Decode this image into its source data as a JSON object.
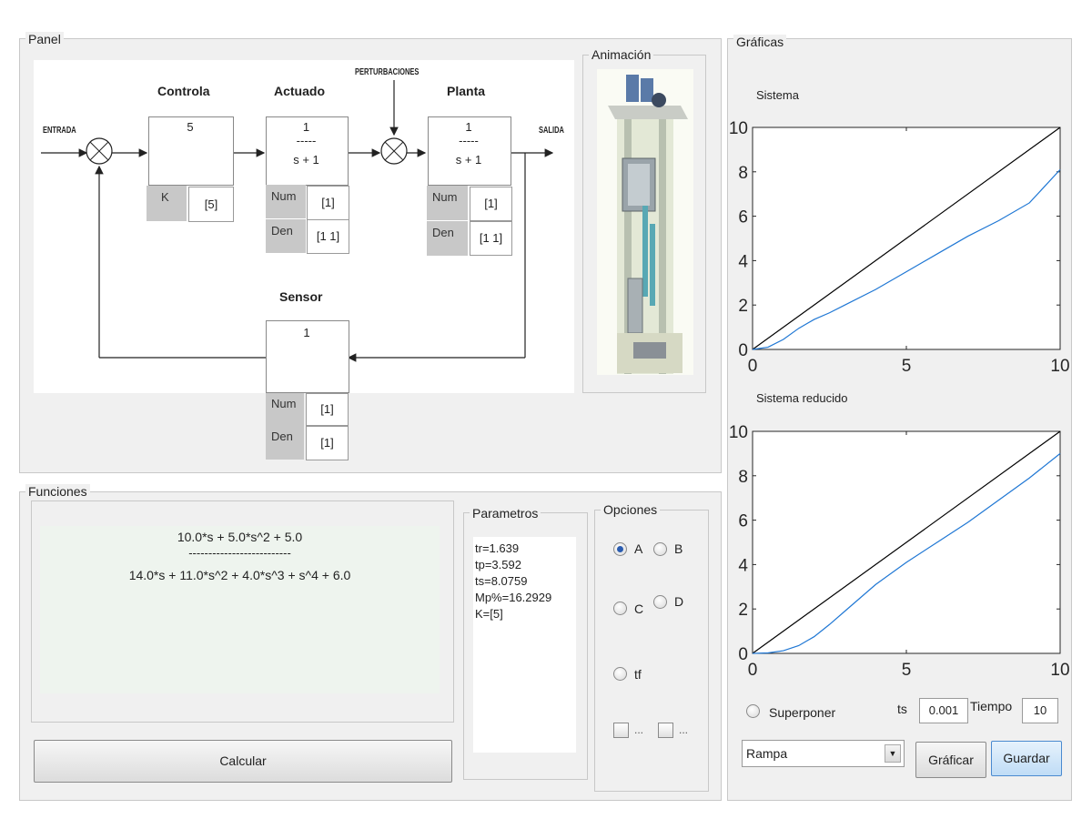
{
  "panel": {
    "title": "Panel",
    "diagram": {
      "entrada": "ENTRADA",
      "salida": "SALIDA",
      "perturbaciones": "PERTURBACIONES",
      "controlador": {
        "title": "Controla",
        "value": "5",
        "k_label": "K",
        "k_value": "[5]"
      },
      "actuador": {
        "title": "Actuado",
        "num_text": "1",
        "den_text": "s + 1",
        "num_label": "Num",
        "num_value": "[1]",
        "den_label": "Den",
        "den_value": "[1 1]"
      },
      "planta": {
        "title": "Planta",
        "num_text": "1",
        "den_text": "s + 1",
        "num_label": "Num",
        "num_value": "[1]",
        "den_label": "Den",
        "den_value": "[1 1]"
      },
      "sensor": {
        "title": "Sensor",
        "value": "1",
        "num_label": "Num",
        "num_value": "[1]",
        "den_label": "Den",
        "den_value": "[1]"
      },
      "frac_line": "-----"
    },
    "animacion_title": "Animación"
  },
  "funciones": {
    "title": "Funciones",
    "numerator": "10.0*s + 5.0*s^2 + 5.0",
    "fraction_bar": "--------------------------",
    "denominator": "14.0*s + 11.0*s^2 + 4.0*s^3 + s^4 + 6.0",
    "calcular_label": "Calcular"
  },
  "parametros": {
    "title": "Parametros",
    "lines": [
      "tr=1.639",
      "tp=3.592",
      "ts=8.0759",
      "Mp%=16.2929",
      "K=[5]"
    ]
  },
  "opciones": {
    "title": "Opciones",
    "radio_a": "A",
    "radio_b": "B",
    "radio_c": "C",
    "radio_d": "D",
    "radio_tf": "tf",
    "check1": "...",
    "check2": "...",
    "selected": "A"
  },
  "graficas": {
    "title": "Gráficas",
    "superponer_label": "Superponer",
    "ts_label": "ts",
    "ts_value": "0.001",
    "tiempo_label": "Tiempo",
    "tiempo_value": "10",
    "signal_selected": "Rampa",
    "graficar_label": "Gráficar",
    "guardar_label": "Guardar"
  },
  "chart_data": [
    {
      "type": "line",
      "title": "Sistema",
      "xlim": [
        0,
        10
      ],
      "ylim": [
        0,
        10
      ],
      "xticks": [
        0,
        5,
        10
      ],
      "yticks": [
        0,
        2,
        4,
        6,
        8,
        10
      ],
      "series": [
        {
          "color": "#000000",
          "x": [
            0,
            10
          ],
          "y": [
            0,
            10
          ]
        },
        {
          "color": "#1f77d4",
          "x": [
            0,
            0.5,
            1,
            1.5,
            2,
            2.5,
            3,
            4,
            5,
            6,
            7,
            8,
            9,
            10
          ],
          "y": [
            0,
            0.1,
            0.45,
            0.95,
            1.35,
            1.65,
            2.0,
            2.7,
            3.5,
            4.3,
            5.1,
            5.8,
            6.6,
            8.1
          ]
        }
      ]
    },
    {
      "type": "line",
      "title": "Sistema reducido",
      "xlim": [
        0,
        10
      ],
      "ylim": [
        0,
        10
      ],
      "xticks": [
        0,
        5,
        10
      ],
      "yticks": [
        0,
        2,
        4,
        6,
        8,
        10
      ],
      "series": [
        {
          "color": "#000000",
          "x": [
            0,
            10
          ],
          "y": [
            0,
            10
          ]
        },
        {
          "color": "#1f77d4",
          "x": [
            0,
            0.5,
            1,
            1.5,
            2,
            2.5,
            3,
            3.5,
            4,
            5,
            6,
            7,
            8,
            9,
            10
          ],
          "y": [
            0,
            0.02,
            0.12,
            0.35,
            0.75,
            1.3,
            1.9,
            2.5,
            3.1,
            4.1,
            5.0,
            5.9,
            6.9,
            7.9,
            9.0
          ]
        }
      ]
    }
  ]
}
